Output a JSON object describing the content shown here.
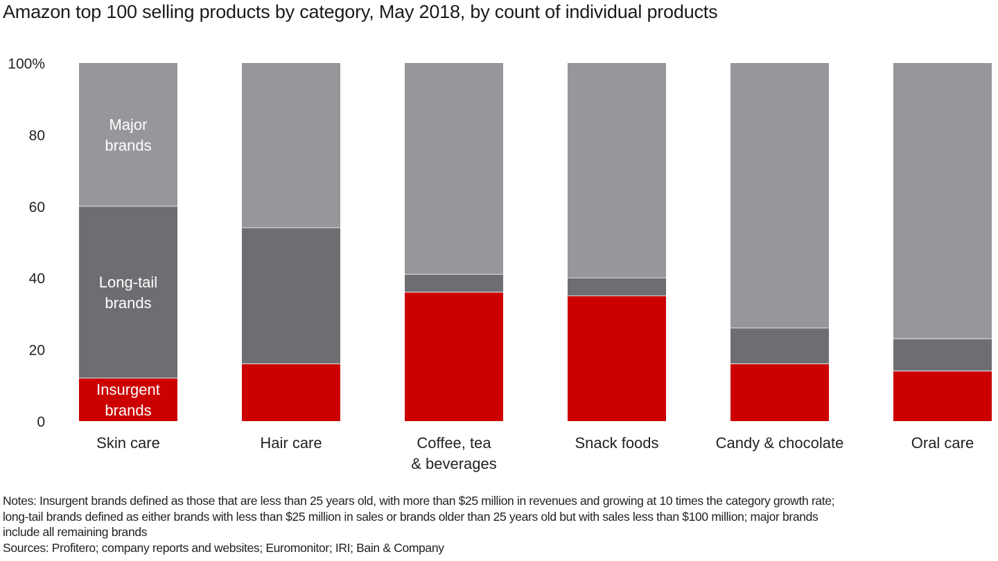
{
  "title": "Amazon top 100 selling products by category, May 2018, by count of individual products",
  "notes": [
    "Notes: Insurgent brands defined as those that are less than 25 years old, with more than $25 million in revenues and growing at 10 times the category growth rate;",
    "long-tail brands defined as either brands with less than $25 million in sales or brands older than 25 years old but with sales less than $100 million; major brands",
    "include all remaining brands"
  ],
  "sources": "Sources: Profitero; company reports and websites; Euromonitor; IRI; Bain & Company",
  "colors": {
    "insurgent": "#cc0000",
    "long_tail": "#6d6e71",
    "major": "#96979a",
    "separator": "#d8d8da"
  },
  "chart_data": {
    "type": "bar",
    "stacked": true,
    "title": "Amazon top 100 selling products by category, May 2018, by count of individual products",
    "xlabel": "",
    "ylabel": "",
    "ylim": [
      0,
      100
    ],
    "yticks": [
      0,
      20,
      40,
      60,
      80,
      100
    ],
    "ytick_labels": [
      "0",
      "20",
      "40",
      "60",
      "80",
      "100%"
    ],
    "grid": false,
    "legend": "inline labels in first bar",
    "categories": [
      [
        "Skin care"
      ],
      [
        "Hair care"
      ],
      [
        "Coffee, tea",
        "& beverages"
      ],
      [
        "Snack foods"
      ],
      [
        "Candy & chocolate"
      ],
      [
        "Oral care"
      ]
    ],
    "series": [
      {
        "name": "Insurgent brands",
        "label_lines": [
          "Insurgent",
          "brands"
        ],
        "color_key": "insurgent",
        "values": [
          12,
          16,
          36,
          35,
          16,
          14
        ]
      },
      {
        "name": "Long-tail brands",
        "label_lines": [
          "Long-tail",
          "brands"
        ],
        "color_key": "long_tail",
        "values": [
          48,
          38,
          5,
          5,
          10,
          9
        ]
      },
      {
        "name": "Major brands",
        "label_lines": [
          "Major",
          "brands"
        ],
        "color_key": "major",
        "values": [
          40,
          46,
          59,
          60,
          74,
          77
        ]
      }
    ]
  }
}
